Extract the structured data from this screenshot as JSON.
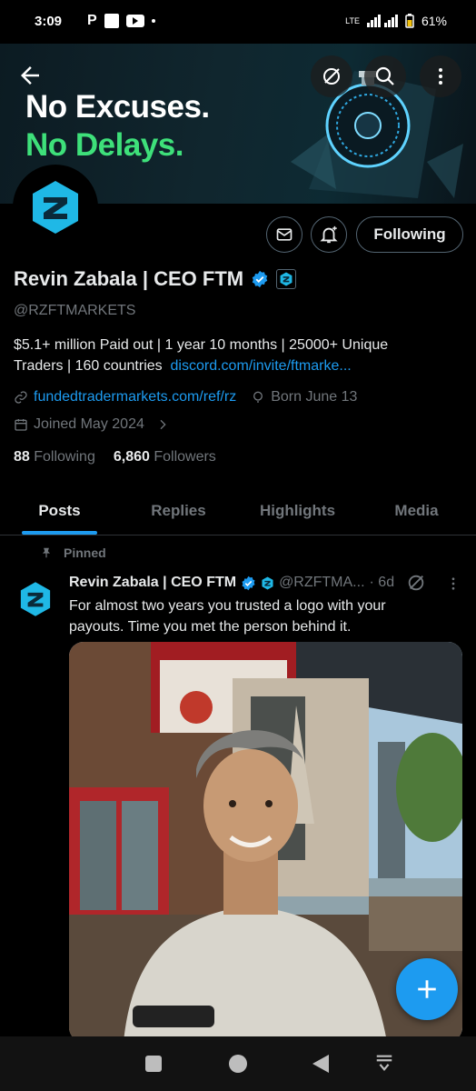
{
  "status_bar": {
    "time": "3:09",
    "battery": "61%",
    "network": "LTE"
  },
  "header": {
    "back_icon": "arrow-left-icon",
    "icons": [
      "grok-icon",
      "search-icon",
      "more-vertical-icon"
    ]
  },
  "banner": {
    "line1": "No Excuses.",
    "line2": "No Delays."
  },
  "profile": {
    "name": "Revin Zabala | CEO FTM",
    "handle": "@RZFTMARKETS",
    "bio_text": "$5.1+ million Paid out | 1 year 10 months | 25000+ Unique Traders | 160 countries",
    "bio_link": "discord.com/invite/ftmarke...",
    "website": "fundedtradermarkets.com/ref/rz",
    "born": "Born June 13",
    "joined": "Joined May 2024",
    "following_count": "88",
    "following_label": "Following",
    "followers_count": "6,860",
    "followers_label": "Followers",
    "follow_button": "Following"
  },
  "tabs": [
    {
      "label": "Posts",
      "active": true
    },
    {
      "label": "Replies",
      "active": false
    },
    {
      "label": "Highlights",
      "active": false
    },
    {
      "label": "Media",
      "active": false
    }
  ],
  "post": {
    "pinned_label": "Pinned",
    "author": "Revin Zabala | CEO FTM",
    "handle": "@RZFTMA...",
    "time": "· 6d",
    "text": "For almost two years you trusted a logo with your payouts. Time you met the person behind it."
  },
  "colors": {
    "accent": "#1d9bf0",
    "banner_green": "#3ee07a",
    "logo_blue": "#1fb8e6"
  }
}
